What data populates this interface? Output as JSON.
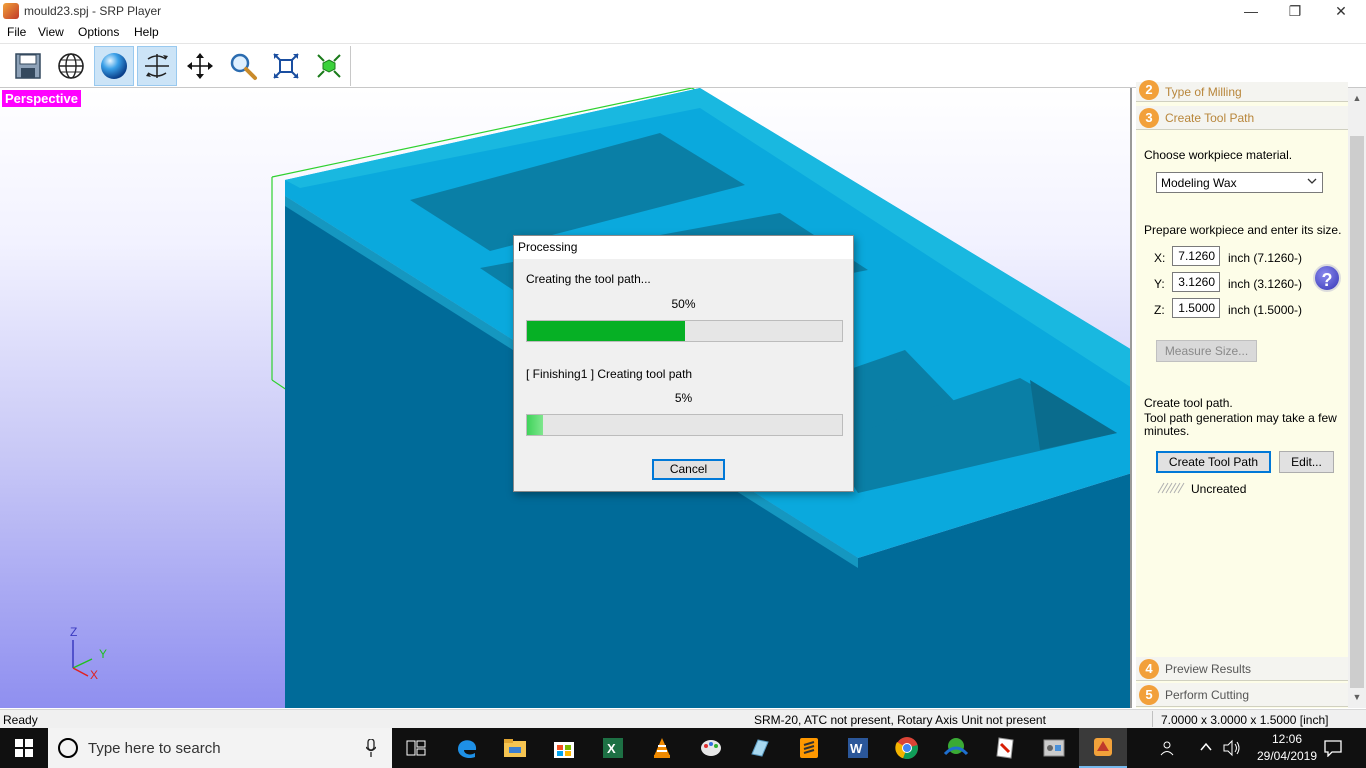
{
  "window": {
    "title": "mould23.spj - SRP Player",
    "minimize": "—",
    "maximize": "❐",
    "close": "✕"
  },
  "menu": [
    "File",
    "View",
    "Options",
    "Help"
  ],
  "toolbar": {
    "icons": [
      "save-icon",
      "globe-icon",
      "sphere-icon",
      "rotate-icon",
      "move-icon",
      "zoom-icon",
      "fit-icon",
      "center-icon"
    ],
    "active": [
      "sphere-icon",
      "rotate-icon"
    ]
  },
  "viewport": {
    "label": "Perspective",
    "axes": {
      "z": "Z",
      "y": "Y",
      "x": "X"
    }
  },
  "panel": {
    "step2": {
      "num": "2",
      "label": "Type of Milling"
    },
    "step3": {
      "num": "3",
      "label": "Create Tool Path"
    },
    "choose_material": "Choose workpiece material.",
    "material": "Modeling Wax",
    "prepare_text": "Prepare workpiece and enter its size.",
    "size": {
      "x": {
        "label": "X:",
        "value": "7.1260",
        "unit": "inch",
        "hint": "(7.1260-)"
      },
      "y": {
        "label": "Y:",
        "value": "3.1260",
        "unit": "inch",
        "hint": "(3.1260-)"
      },
      "z": {
        "label": "Z:",
        "value": "1.5000",
        "unit": "inch",
        "hint": "(1.5000-)"
      }
    },
    "help": "?",
    "measure_button": "Measure Size...",
    "create_text_1": "Create tool path.",
    "create_text_2": "Tool path generation may take a few minutes.",
    "create_button": "Create Tool Path",
    "edit_button": "Edit...",
    "status": "Uncreated",
    "step4": {
      "num": "4",
      "label": "Preview Results"
    },
    "step5": {
      "num": "5",
      "label": "Perform Cutting"
    }
  },
  "statusbar": {
    "left": "Ready",
    "middle": "SRM-20, ATC not present, Rotary Axis Unit not present",
    "right": "7.0000 x 3.0000 x 1.5000 [inch]"
  },
  "dialog": {
    "title": "Processing",
    "line1": "Creating the tool path...",
    "percent1": "50%",
    "progress1": 0.5,
    "line2": "[ Finishing1 ] Creating tool path",
    "percent2": "5%",
    "progress2": 0.05,
    "cancel": "Cancel"
  },
  "taskbar": {
    "search_placeholder": "Type here to search",
    "apps": [
      "task-view-icon",
      "edge-icon",
      "file-explorer-icon",
      "store-icon",
      "excel-icon",
      "vlc-icon",
      "paint-icon",
      "app-icon",
      "sublime-icon",
      "word-icon",
      "chrome-icon",
      "network-icon",
      "pdf-icon",
      "control-icon",
      "srp-player-icon"
    ],
    "time": "12:06",
    "date": "29/04/2019"
  },
  "colors": {
    "accent": "#0078d7",
    "progress": "#06b025",
    "perspective_label": "#ff00ff",
    "step_badge": "#f2a03a"
  }
}
